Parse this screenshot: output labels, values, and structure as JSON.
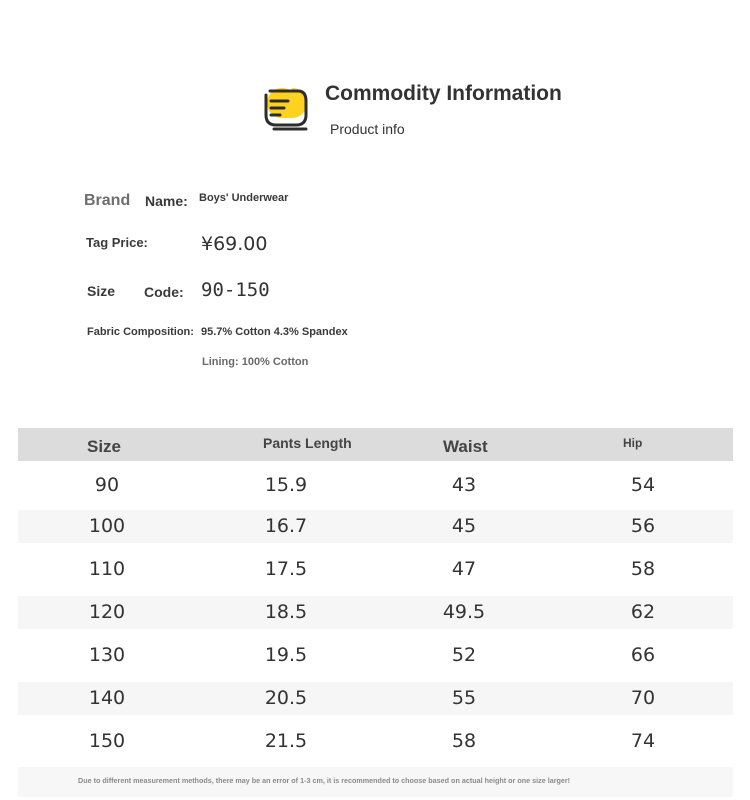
{
  "header": {
    "title": "Commodity Information",
    "subtitle": "Product info",
    "logo_icon": "list-document-icon",
    "accent": "#FFD21F"
  },
  "info": {
    "brand_label_1": "Brand",
    "brand_label_2": "Name:",
    "brand_value": "Boys' Underwear",
    "tag_label": "Tag Price:",
    "tag_value": "¥69.00",
    "size_label_1": "Size",
    "size_label_2": "Code:",
    "size_value": "90-150",
    "fabric_label": "Fabric Composition:",
    "fabric_value": "95.7% Cotton 4.3% Spandex",
    "lining_value": "Lining: 100% Cotton"
  },
  "table": {
    "headers": [
      "Size",
      "Pants Length",
      "Waist",
      "Hip"
    ],
    "rows": [
      [
        "90",
        "15.9",
        "43",
        "54"
      ],
      [
        "100",
        "16.7",
        "45",
        "56"
      ],
      [
        "110",
        "17.5",
        "47",
        "58"
      ],
      [
        "120",
        "18.5",
        "49.5",
        "62"
      ],
      [
        "130",
        "19.5",
        "52",
        "66"
      ],
      [
        "140",
        "20.5",
        "55",
        "70"
      ],
      [
        "150",
        "21.5",
        "58",
        "74"
      ]
    ]
  },
  "footnote": "Due to different measurement methods, there may be an error of 1-3 cm, it is recommended to choose based on actual height or one size larger!"
}
